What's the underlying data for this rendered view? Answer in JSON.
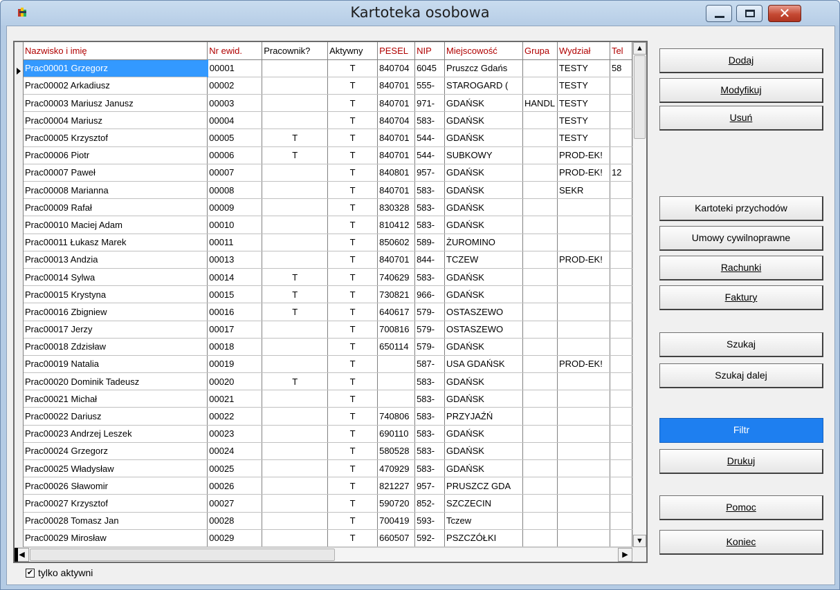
{
  "window": {
    "title": "Kartoteka osobowa"
  },
  "grid": {
    "columns": [
      "Nazwisko i imię",
      "Nr ewid.",
      "Pracownik?",
      "Aktywny",
      "PESEL",
      "NIP",
      "Miejscowość",
      "Grupa",
      "Wydział",
      "Tel"
    ],
    "rows": [
      [
        "Prac00001  Grzegorz",
        "00001",
        "",
        "T",
        "840704",
        "6045",
        "Pruszcz Gdańs",
        "",
        "TESTY",
        "58"
      ],
      [
        "Prac00002  Arkadiusz",
        "00002",
        "",
        "T",
        "840701",
        "555-",
        "STAROGARD (",
        "",
        "TESTY",
        ""
      ],
      [
        "Prac00003  Mariusz Janusz",
        "00003",
        "",
        "T",
        "840701",
        "971-",
        "GDAŃSK",
        "HANDL",
        "TESTY",
        ""
      ],
      [
        "Prac00004  Mariusz",
        "00004",
        "",
        "T",
        "840704",
        "583-",
        "GDAŃSK",
        "",
        "TESTY",
        ""
      ],
      [
        "Prac00005  Krzysztof",
        "00005",
        "T",
        "T",
        "840701",
        "544-",
        "GDAŃSK",
        "",
        "TESTY",
        ""
      ],
      [
        "Prac00006  Piotr",
        "00006",
        "T",
        "T",
        "840701",
        "544-",
        "SUBKOWY",
        "",
        "PROD-EK!",
        ""
      ],
      [
        "Prac00007  Paweł",
        "00007",
        "",
        "T",
        "840801",
        "957-",
        "GDAŃSK",
        "",
        "PROD-EK!",
        "12"
      ],
      [
        "Prac00008  Marianna",
        "00008",
        "",
        "T",
        "840701",
        "583-",
        "GDAŃSK",
        "",
        "SEKR",
        ""
      ],
      [
        "Prac00009  Rafał",
        "00009",
        "",
        "T",
        "830328",
        "583-",
        "GDAŃSK",
        "",
        "",
        ""
      ],
      [
        "Prac00010  Maciej Adam",
        "00010",
        "",
        "T",
        "810412",
        "583-",
        "GDAŃSK",
        "",
        "",
        ""
      ],
      [
        "Prac00011  Łukasz Marek",
        "00011",
        "",
        "T",
        "850602",
        "589-",
        "ŻUROMINO",
        "",
        "",
        ""
      ],
      [
        "Prac00013  Andzia",
        "00013",
        "",
        "T",
        "840701",
        "844-",
        "TCZEW",
        "",
        "PROD-EK!",
        ""
      ],
      [
        "Prac00014  Sylwa",
        "00014",
        "T",
        "T",
        "740629",
        "583-",
        "GDAŃSK",
        "",
        "",
        ""
      ],
      [
        "Prac00015  Krystyna",
        "00015",
        "T",
        "T",
        "730821",
        "966-",
        "GDAŃSK",
        "",
        "",
        ""
      ],
      [
        "Prac00016  Zbigniew",
        "00016",
        "T",
        "T",
        "640617",
        "579-",
        "OSTASZEWO",
        "",
        "",
        ""
      ],
      [
        "Prac00017  Jerzy",
        "00017",
        "",
        "T",
        "700816",
        "579-",
        "OSTASZEWO",
        "",
        "",
        ""
      ],
      [
        "Prac00018  Zdzisław",
        "00018",
        "",
        "T",
        "650114",
        "579-",
        "GDAŃSK",
        "",
        "",
        ""
      ],
      [
        "Prac00019  Natalia",
        "00019",
        "",
        "T",
        "",
        "587-",
        "USA GDAŃSK",
        "",
        "PROD-EK!",
        ""
      ],
      [
        "Prac00020  Dominik Tadeusz",
        "00020",
        "T",
        "T",
        "",
        "583-",
        "GDAŃSK",
        "",
        "",
        ""
      ],
      [
        "Prac00021  Michał",
        "00021",
        "",
        "T",
        "",
        "583-",
        "GDAŃSK",
        "",
        "",
        ""
      ],
      [
        "Prac00022  Dariusz",
        "00022",
        "",
        "T",
        "740806",
        "583-",
        "PRZYJAŹŃ",
        "",
        "",
        ""
      ],
      [
        "Prac00023  Andrzej Leszek",
        "00023",
        "",
        "T",
        "690110",
        "583-",
        "GDAŃSK",
        "",
        "",
        ""
      ],
      [
        "Prac00024  Grzegorz",
        "00024",
        "",
        "T",
        "580528",
        "583-",
        "GDAŃSK",
        "",
        "",
        ""
      ],
      [
        "Prac00025  Władysław",
        "00025",
        "",
        "T",
        "470929",
        "583-",
        "GDAŃSK",
        "",
        "",
        ""
      ],
      [
        "Prac00026  Sławomir",
        "00026",
        "",
        "T",
        "821227",
        "957-",
        "PRUSZCZ GDA",
        "",
        "",
        ""
      ],
      [
        "Prac00027  Krzysztof",
        "00027",
        "",
        "T",
        "590720",
        "852-",
        "SZCZECIN",
        "",
        "",
        ""
      ],
      [
        "Prac00028  Tomasz Jan",
        "00028",
        "",
        "T",
        "700419",
        "593-",
        "Tczew",
        "",
        "",
        ""
      ],
      [
        "Prac00029  Mirosław",
        "00029",
        "",
        "T",
        "660507",
        "592-",
        "PSZCZÓŁKI",
        "",
        "",
        ""
      ]
    ]
  },
  "buttons": {
    "dodaj": "Dodaj",
    "modyfikuj": "Modyfikuj",
    "usun": "Usuń",
    "kartoteki": "Kartoteki przychodów",
    "umowy": "Umowy cywilnoprawne",
    "rachunki": "Rachunki",
    "faktury": "Faktury",
    "szukaj": "Szukaj",
    "szukaj_dalej": "Szukaj dalej",
    "filtr": "Filtr",
    "drukuj": "Drukuj",
    "pomoc": "Pomoc",
    "koniec": "Koniec"
  },
  "filter": {
    "only_active_label": "tylko aktywni",
    "only_active_checked": true
  },
  "icons": {
    "app": "app-icon",
    "minimize": "minimize-icon",
    "maximize": "maximize-icon",
    "close": "close-icon"
  },
  "colors": {
    "header_text": "#b00000",
    "selection": "#3399ff",
    "active_button": "#1e7ff0"
  }
}
